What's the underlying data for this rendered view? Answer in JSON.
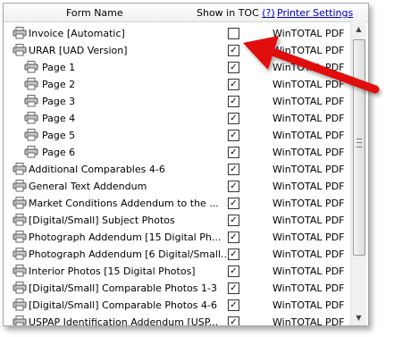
{
  "header": {
    "form_name": "Form Name",
    "show_in_toc": "Show in TOC",
    "help": "(?)",
    "printer_settings": "Printer Settings"
  },
  "rows": [
    {
      "name": "Invoice [Automatic]",
      "checked": false,
      "printer": "WinTOTAL PDF",
      "indent": 0
    },
    {
      "name": "URAR [UAD Version]",
      "checked": true,
      "printer": "WinTOTAL PDF",
      "indent": 0
    },
    {
      "name": "Page 1",
      "checked": true,
      "printer": "WinTOTAL PDF",
      "indent": 1
    },
    {
      "name": "Page 2",
      "checked": true,
      "printer": "WinTOTAL PDF",
      "indent": 1
    },
    {
      "name": "Page 3",
      "checked": true,
      "printer": "WinTOTAL PDF",
      "indent": 1
    },
    {
      "name": "Page 4",
      "checked": true,
      "printer": "WinTOTAL PDF",
      "indent": 1
    },
    {
      "name": "Page 5",
      "checked": true,
      "printer": "WinTOTAL PDF",
      "indent": 1
    },
    {
      "name": "Page 6",
      "checked": true,
      "printer": "WinTOTAL PDF",
      "indent": 1
    },
    {
      "name": "Additional Comparables 4-6",
      "checked": true,
      "printer": "WinTOTAL PDF",
      "indent": 0
    },
    {
      "name": "General Text Addendum",
      "checked": true,
      "printer": "WinTOTAL PDF",
      "indent": 0
    },
    {
      "name": "Market Conditions Addendum to the ...",
      "checked": true,
      "printer": "WinTOTAL PDF",
      "indent": 0
    },
    {
      "name": "[Digital/Small] Subject Photos",
      "checked": true,
      "printer": "WinTOTAL PDF",
      "indent": 0
    },
    {
      "name": "Photograph Addendum [15 Digital Ph...",
      "checked": true,
      "printer": "WinTOTAL PDF",
      "indent": 0
    },
    {
      "name": "Photograph Addendum [6 Digital/Small...",
      "checked": true,
      "printer": "WinTOTAL PDF",
      "indent": 0
    },
    {
      "name": "Interior Photos [15 Digital Photos]",
      "checked": true,
      "printer": "WinTOTAL PDF",
      "indent": 0
    },
    {
      "name": "[Digital/Small] Comparable Photos 1-3",
      "checked": true,
      "printer": "WinTOTAL PDF",
      "indent": 0
    },
    {
      "name": "[Digital/Small] Comparable Photos 4-6",
      "checked": true,
      "printer": "WinTOTAL PDF",
      "indent": 0
    },
    {
      "name": "USPAP Identification Addendum [USP...",
      "checked": true,
      "printer": "WinTOTAL PDF",
      "indent": 0
    }
  ],
  "icons": {
    "row": "printer-icon",
    "annotation": "red-arrow-icon"
  },
  "colors": {
    "link": "#0000cc",
    "arrow": "#e01010"
  }
}
